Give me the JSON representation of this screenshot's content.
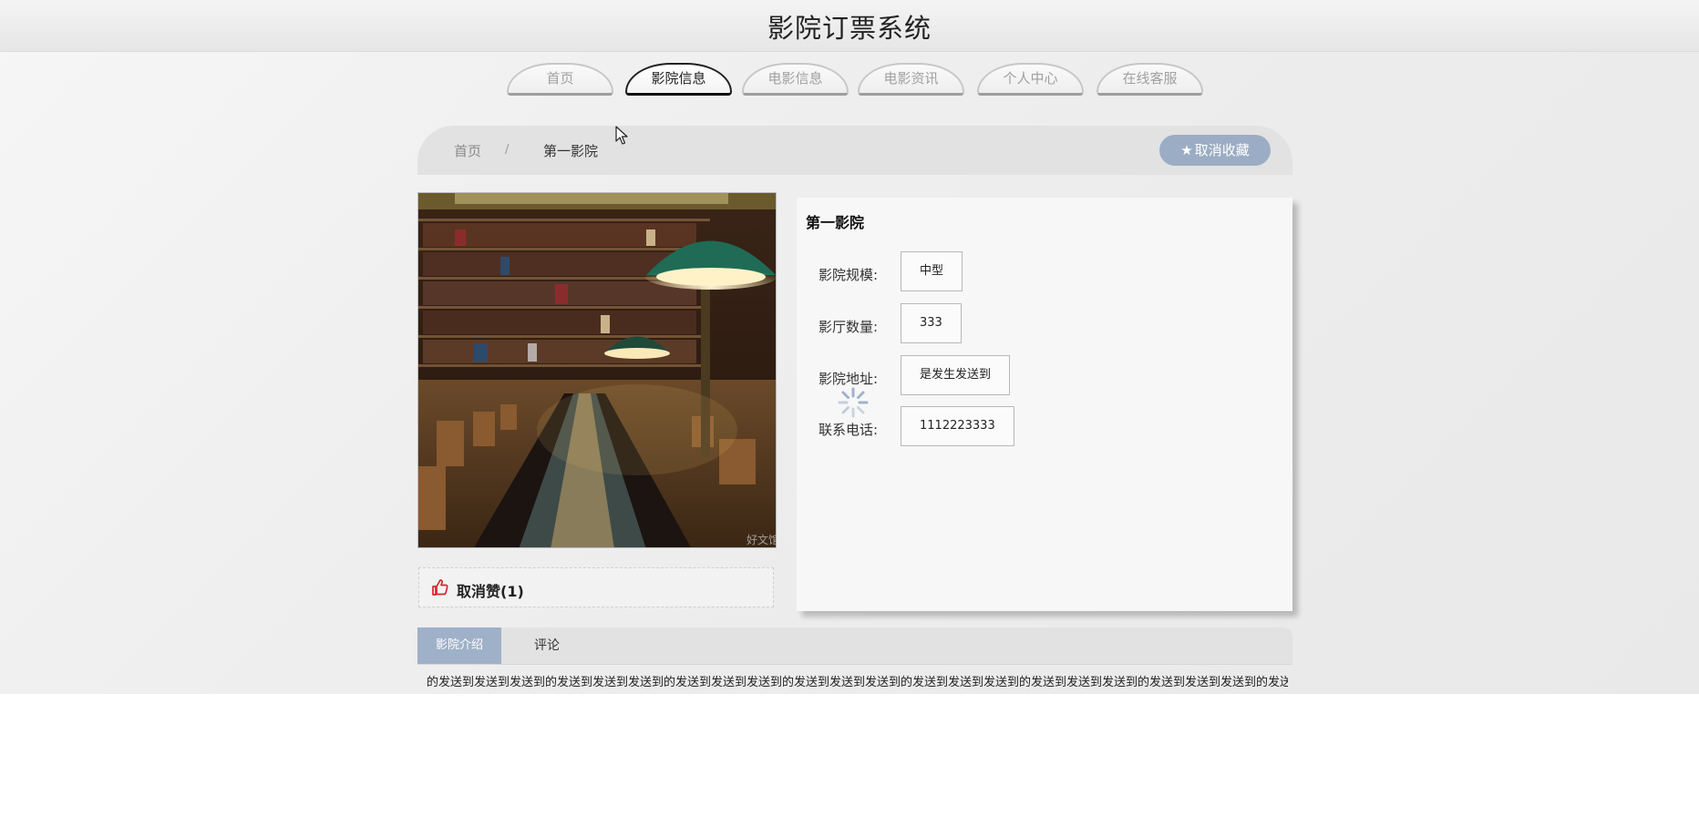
{
  "header": {
    "title": "影院订票系统"
  },
  "nav": {
    "tabs": [
      {
        "label": "首页",
        "active": false
      },
      {
        "label": "影院信息",
        "active": true
      },
      {
        "label": "电影信息",
        "active": false
      },
      {
        "label": "电影资讯",
        "active": false
      },
      {
        "label": "个人中心",
        "active": false
      },
      {
        "label": "在线客服",
        "active": false
      }
    ]
  },
  "breadcrumb": {
    "home": "首页",
    "separator": "/",
    "current": "第一影院"
  },
  "favorite_button": {
    "icon": "star-icon",
    "label": "取消收藏"
  },
  "cinema": {
    "image_icon": "cinema-photo",
    "image_watermark": "好文馆",
    "name": "第一影院",
    "fields": [
      {
        "label": "影院规模:",
        "value": "中型"
      },
      {
        "label": "影厅数量:",
        "value": "333"
      },
      {
        "label": "影院地址:",
        "value": "是发生发送到"
      },
      {
        "label": "联系电话:",
        "value": "1112223333"
      }
    ]
  },
  "like": {
    "icon": "thumbs-up-icon",
    "label": "取消赞(1)"
  },
  "detail_tabs": {
    "intro": "影院介绍",
    "comment": "评论"
  },
  "intro_text": "的发送到发送到发送到的发送到发送到发送到的发送到发送到发送到的发送到发送到发送到的发送到发送到发送到的发送到发送到发送到的发送到发送到发送到的发送到发送到发",
  "colors": {
    "accent": "#9badc4",
    "tab_active": "#9fb1c8",
    "like_icon": "#d9232d"
  }
}
